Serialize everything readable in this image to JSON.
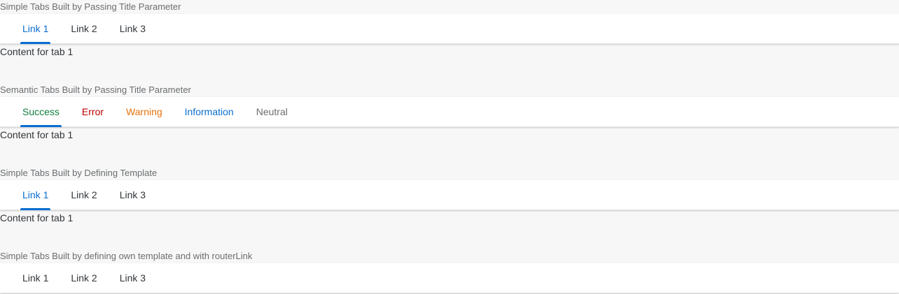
{
  "sections": [
    {
      "title": "Simple Tabs Built by Passing Title Parameter",
      "tabs": [
        "Link 1",
        "Link 2",
        "Link 3"
      ],
      "selected_index": 0,
      "content": "Content for tab 1"
    },
    {
      "title": "Semantic Tabs Built by Passing Title Parameter",
      "tabs": [
        "Success",
        "Error",
        "Warning",
        "Information",
        "Neutral"
      ],
      "selected_index": 0,
      "content": "Content for tab 1"
    },
    {
      "title": "Simple Tabs Built by Defining Template",
      "tabs": [
        "Link 1",
        "Link 2",
        "Link 3"
      ],
      "selected_index": 0,
      "content": "Content for tab 1"
    },
    {
      "title": "Simple Tabs Built by defining own template and with routerLink",
      "tabs": [
        "Link 1",
        "Link 2",
        "Link 3"
      ],
      "selected_index": null,
      "content": ""
    }
  ],
  "colors": {
    "accent": "#0a6ed1",
    "success": "#107e3e",
    "error": "#bb0000",
    "warning": "#e9730c",
    "information": "#0a6ed1",
    "neutral": "#6a6d70"
  }
}
